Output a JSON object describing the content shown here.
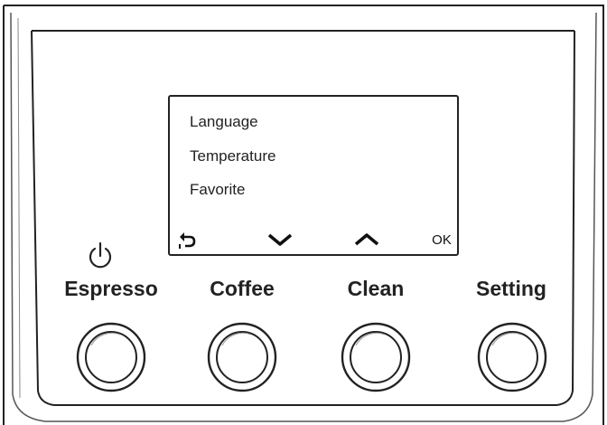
{
  "display": {
    "menu_items": [
      "Language",
      "Temperature",
      "Favorite"
    ],
    "nav": {
      "ok_label": "OK"
    }
  },
  "buttons": [
    {
      "label": "Espresso",
      "icon": "power-icon"
    },
    {
      "label": "Coffee"
    },
    {
      "label": "Clean"
    },
    {
      "label": "Setting"
    }
  ],
  "icons": {
    "back": "back-arrow-icon",
    "down": "chevron-down-icon",
    "up": "chevron-up-icon",
    "power": "power-icon"
  },
  "colors": {
    "line": "#222222",
    "background": "#ffffff"
  }
}
